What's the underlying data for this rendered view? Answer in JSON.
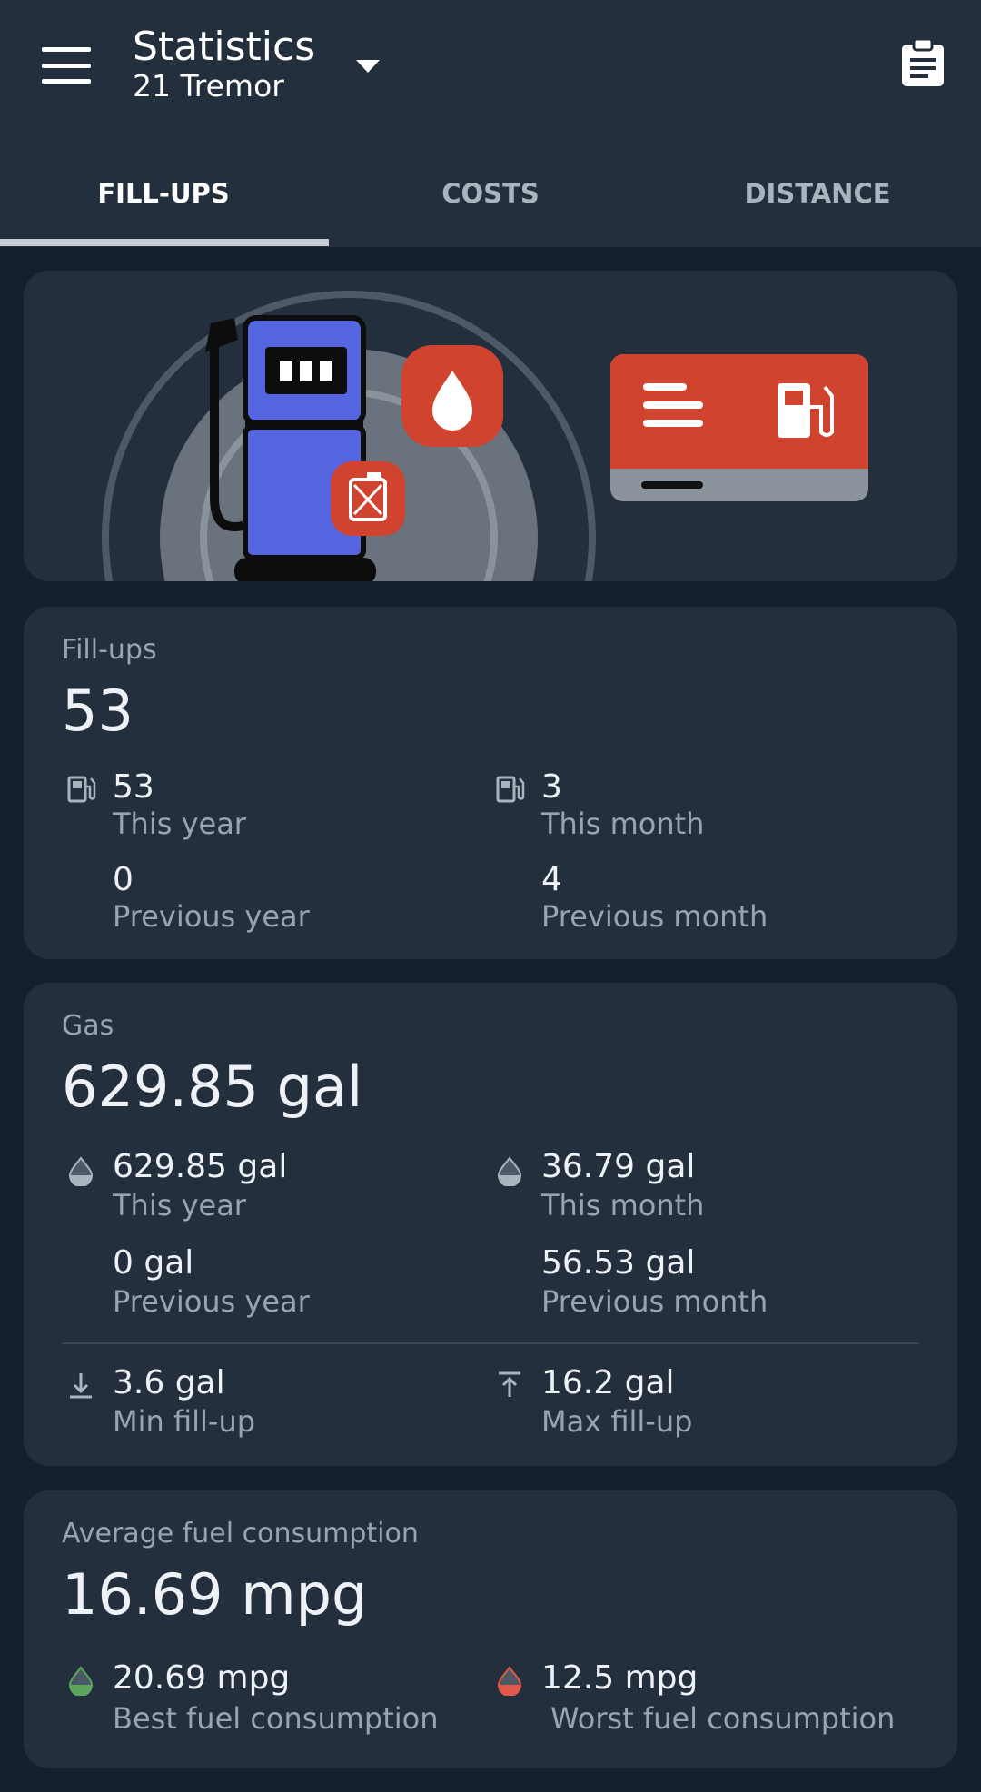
{
  "header": {
    "title": "Statistics",
    "subtitle": "21 Tremor"
  },
  "tabs": [
    {
      "label": "FILL-UPS",
      "active": true
    },
    {
      "label": "COSTS",
      "active": false
    },
    {
      "label": "DISTANCE",
      "active": false
    }
  ],
  "fillups": {
    "label": "Fill-ups",
    "total": "53",
    "this_year": {
      "value": "53",
      "label": "This year"
    },
    "this_month": {
      "value": "3",
      "label": "This month"
    },
    "previous_year": {
      "value": "0",
      "label": "Previous year"
    },
    "previous_month": {
      "value": "4",
      "label": "Previous month"
    }
  },
  "gas": {
    "label": "Gas",
    "total": "629.85 gal",
    "this_year": {
      "value": "629.85 gal",
      "label": "This year"
    },
    "this_month": {
      "value": "36.79 gal",
      "label": "This month"
    },
    "previous_year": {
      "value": "0 gal",
      "label": "Previous year"
    },
    "previous_month": {
      "value": "56.53 gal",
      "label": "Previous month"
    },
    "min_fillup": {
      "value": "3.6 gal",
      "label": "Min fill-up"
    },
    "max_fillup": {
      "value": "16.2 gal",
      "label": "Max fill-up"
    }
  },
  "consumption": {
    "label": "Average fuel consumption",
    "average": "16.69 mpg",
    "best": {
      "value": "20.69 mpg",
      "label": "Best fuel consumption"
    },
    "worst": {
      "value": "12.5 mpg",
      "label": "Worst fuel consumption"
    }
  },
  "colors": {
    "background": "#16202c",
    "card": "#242f3d",
    "accent_red": "#d0432f",
    "pump_blue": "#5566e0",
    "best_green": "#5aa65a",
    "worst_red": "#e0584a"
  }
}
